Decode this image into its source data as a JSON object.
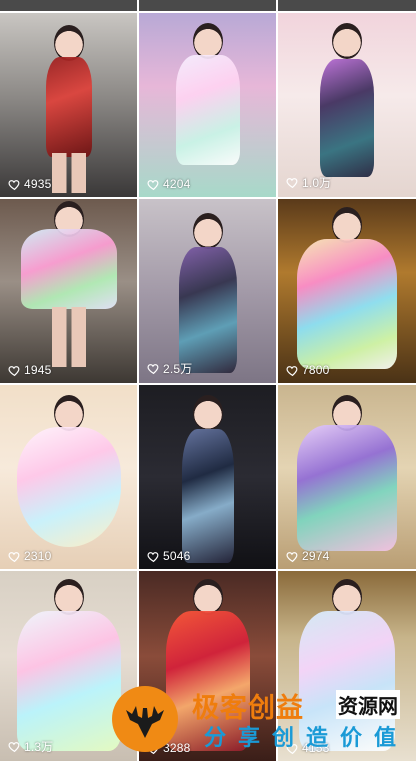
{
  "items": [
    {
      "likes": "4935"
    },
    {
      "likes": "4204"
    },
    {
      "likes": "1.0万"
    },
    {
      "likes": "1945"
    },
    {
      "likes": "2.5万"
    },
    {
      "likes": "7800"
    },
    {
      "likes": "2310"
    },
    {
      "likes": "5046"
    },
    {
      "likes": "2974"
    },
    {
      "likes": "1.3万"
    },
    {
      "likes": "3288"
    },
    {
      "likes": "4153"
    }
  ],
  "watermark": {
    "line1": "极客创益",
    "line1b": "资源网",
    "line2": "分享创造价值"
  },
  "colors": {
    "like_text": "#ffffff",
    "watermark_orange": "#ef7d0d",
    "watermark_blue": "#1a9ad6"
  },
  "icons": {
    "like": "heart-outline-icon"
  }
}
